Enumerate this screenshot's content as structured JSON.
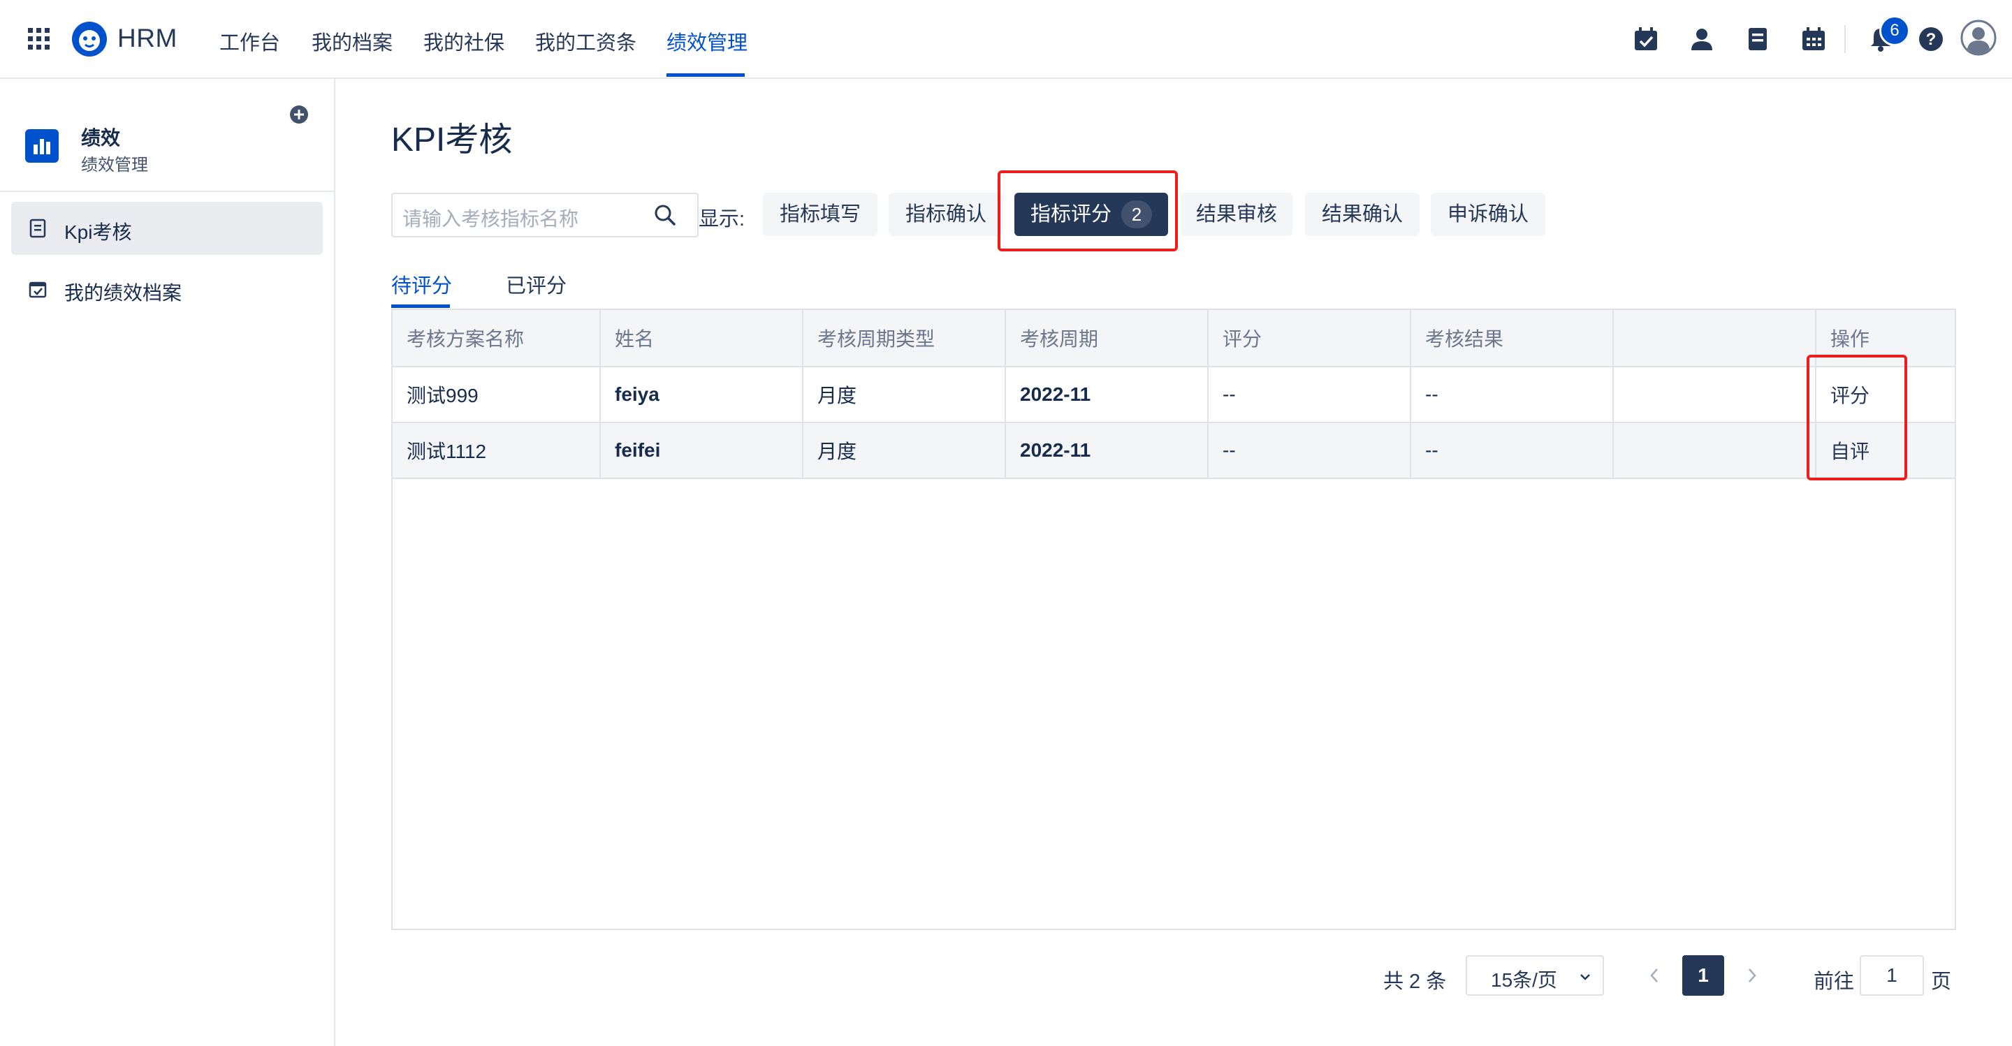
{
  "topnav": {
    "brand": "HRM",
    "items": [
      {
        "label": "工作台"
      },
      {
        "label": "我的档案"
      },
      {
        "label": "我的社保"
      },
      {
        "label": "我的工资条"
      },
      {
        "label": "绩效管理"
      }
    ],
    "active_item": "绩效管理",
    "notifications_count": "6",
    "accent_color": "#0052cc"
  },
  "sidebar": {
    "title": "绩效",
    "subtitle": "绩效管理",
    "items": [
      {
        "label": "Kpi考核",
        "icon": "document-icon"
      },
      {
        "label": "我的绩效档案",
        "icon": "calendar-check-icon"
      }
    ],
    "active_item": "Kpi考核"
  },
  "main": {
    "title": "KPI考核",
    "search": {
      "placeholder": "请输入考核指标名称",
      "value": ""
    },
    "show_label": "显示:",
    "filters": [
      {
        "label": "指标填写"
      },
      {
        "label": "指标确认"
      },
      {
        "label": "指标评分",
        "count": "2"
      },
      {
        "label": "结果审核"
      },
      {
        "label": "结果确认"
      },
      {
        "label": "申诉确认"
      }
    ],
    "active_filter": "指标评分",
    "subtabs": [
      {
        "label": "待评分"
      },
      {
        "label": "已评分"
      }
    ],
    "active_subtab": "待评分",
    "table": {
      "columns": [
        "考核方案名称",
        "姓名",
        "考核周期类型",
        "考核周期",
        "评分",
        "考核结果",
        "",
        "操作"
      ],
      "rows": [
        {
          "plan": "测试999",
          "name": "feiya",
          "cycle_type": "月度",
          "cycle": "2022-11",
          "score": "--",
          "result": "--",
          "extra": "",
          "action": "评分"
        },
        {
          "plan": "测试1112",
          "name": "feifei",
          "cycle_type": "月度",
          "cycle": "2022-11",
          "score": "--",
          "result": "--",
          "extra": "",
          "action": "自评"
        }
      ]
    },
    "pagination": {
      "total": "共 2 条",
      "page_size": "15条/页",
      "current_page": "1",
      "goto_label": "前往",
      "goto_value": "1",
      "page_suffix": "页"
    }
  },
  "highlight_color": "#ee1d1d"
}
